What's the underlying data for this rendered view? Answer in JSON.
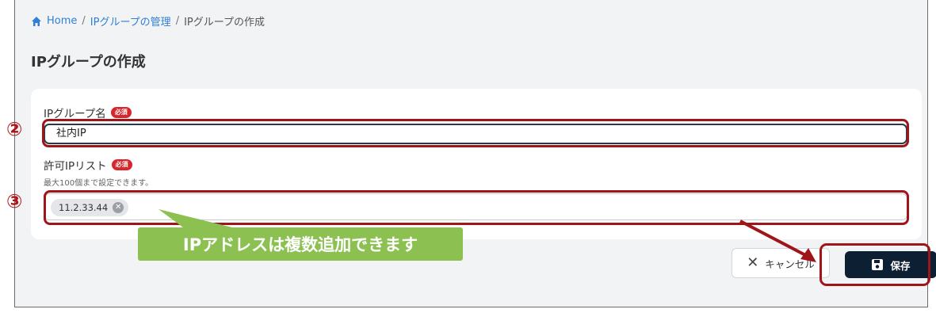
{
  "breadcrumb": {
    "home": "Home",
    "sep1": "/",
    "ip_group_manage": "IPグループの管理",
    "sep2": "/",
    "current": "IPグループの作成"
  },
  "page_title": "IPグループの作成",
  "form": {
    "name_label": "IPグループ名",
    "required_badge": "必須",
    "name_value": "社内IP",
    "ip_list_label": "許可IPリスト",
    "ip_list_hint": "最大100個まで設定できます。",
    "ip_chips": [
      "11.2.33.44"
    ]
  },
  "annotations": {
    "step2": "②",
    "step3": "③",
    "callout_text": "IPアドレスは複数追加できます",
    "highlight_color": "#a0151a",
    "callout_color": "#8cc152"
  },
  "buttons": {
    "cancel": "キャンセル",
    "save": "保存"
  },
  "colors": {
    "link": "#2f7fd6",
    "badge": "#d9262c",
    "primary": "#0d1f33"
  }
}
